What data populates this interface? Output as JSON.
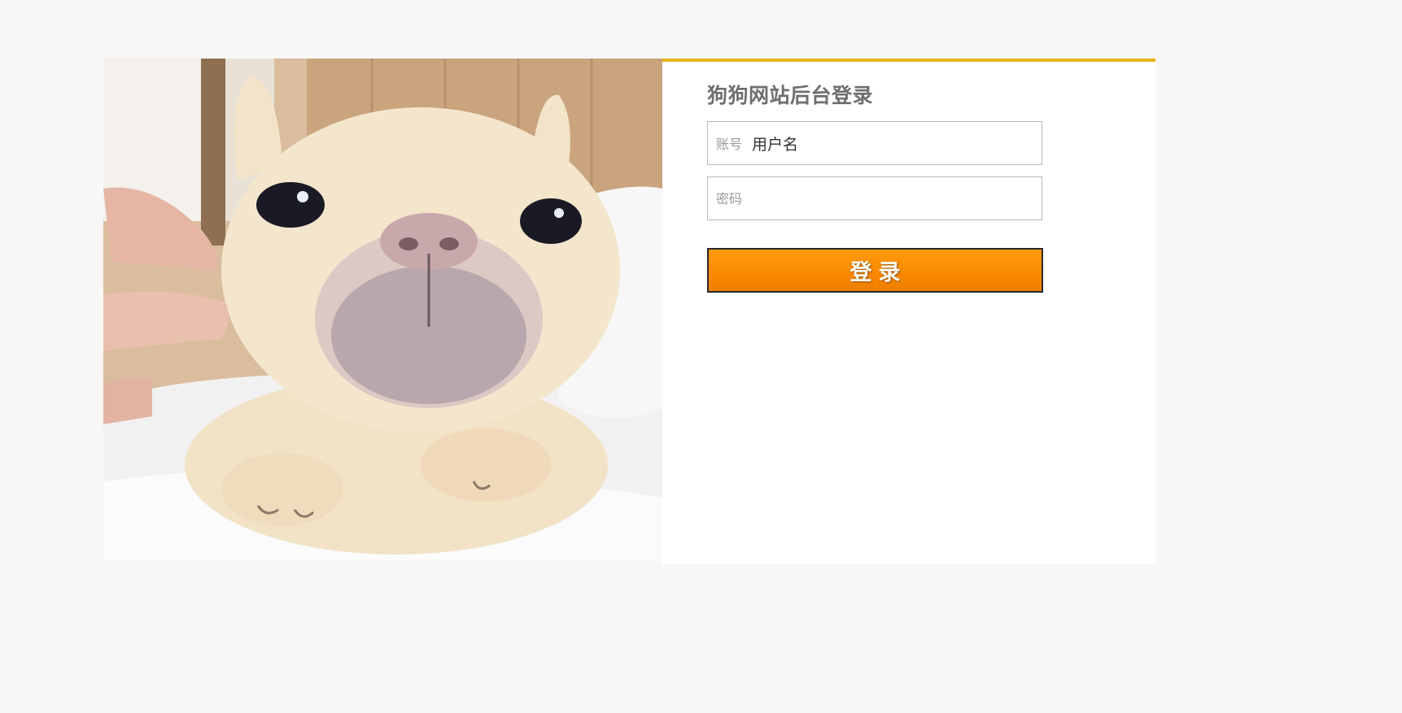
{
  "login": {
    "title": "狗狗网站后台登录",
    "account_label": "账号",
    "account_value": "用户名",
    "password_placeholder": "密码",
    "submit_label": "登录"
  },
  "photo": {
    "subject": "french-bulldog-photo"
  },
  "colors": {
    "page_background": "#f7f7f7",
    "panel_accent": "#e5b411",
    "button_orange": "#f98a00",
    "title_gray": "#6e6e6e"
  }
}
